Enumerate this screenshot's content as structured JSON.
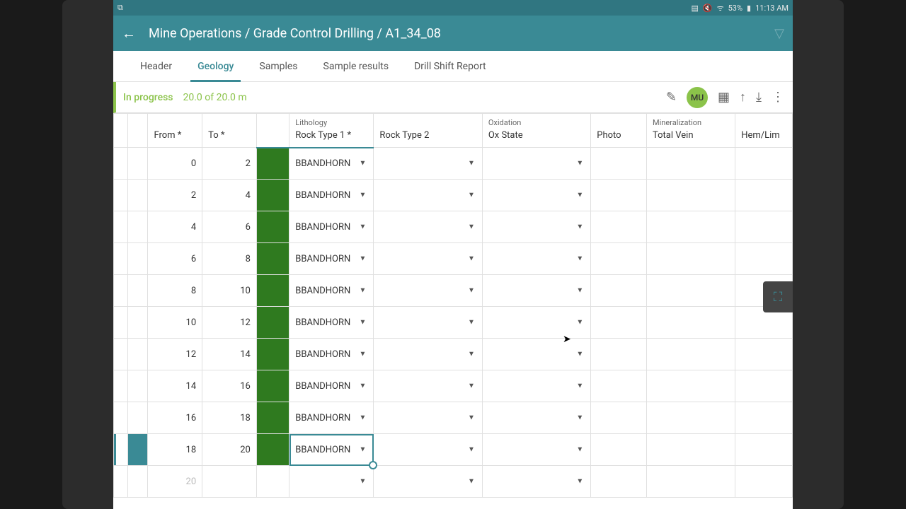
{
  "status_bar": {
    "battery": "53%",
    "time": "11:13 AM"
  },
  "app_bar": {
    "breadcrumb": "Mine Operations / Grade Control Drilling / A1_34_08"
  },
  "tabs": [
    {
      "label": "Header",
      "active": false
    },
    {
      "label": "Geology",
      "active": true
    },
    {
      "label": "Samples",
      "active": false
    },
    {
      "label": "Sample results",
      "active": false
    },
    {
      "label": "Drill Shift Report",
      "active": false
    }
  ],
  "progress": {
    "status_label": "In progress",
    "depth_label": "20.0 of 20.0 m"
  },
  "toolbar": {
    "avatar": "MU"
  },
  "columns": {
    "from": "From *",
    "to": "To *",
    "lithology_group": "Lithology",
    "rock1": "Rock Type 1 *",
    "rock2": "Rock Type 2",
    "oxidation_group": "Oxidation",
    "ox_state": "Ox State",
    "photo": "Photo",
    "mineral_group": "Mineralization",
    "total_vein": "Total Vein",
    "hem_lim": "Hem/Lim"
  },
  "rows": [
    {
      "from": "0",
      "to": "2",
      "rock1": "BBANDHORN",
      "color": "green"
    },
    {
      "from": "2",
      "to": "4",
      "rock1": "BBANDHORN",
      "color": "green"
    },
    {
      "from": "4",
      "to": "6",
      "rock1": "BBANDHORN",
      "color": "green"
    },
    {
      "from": "6",
      "to": "8",
      "rock1": "BBANDHORN",
      "color": "green"
    },
    {
      "from": "8",
      "to": "10",
      "rock1": "BBANDHORN",
      "color": "green"
    },
    {
      "from": "10",
      "to": "12",
      "rock1": "BBANDHORN",
      "color": "green"
    },
    {
      "from": "12",
      "to": "14",
      "rock1": "BBANDHORN",
      "color": "green"
    },
    {
      "from": "14",
      "to": "16",
      "rock1": "BBANDHORN",
      "color": "green"
    },
    {
      "from": "16",
      "to": "18",
      "rock1": "BBANDHORN",
      "color": "green"
    },
    {
      "from": "18",
      "to": "20",
      "rock1": "BBANDHORN",
      "color": "green",
      "selected": true
    },
    {
      "from": "20",
      "to": "",
      "rock1": "",
      "color": "",
      "placeholder": true
    }
  ]
}
